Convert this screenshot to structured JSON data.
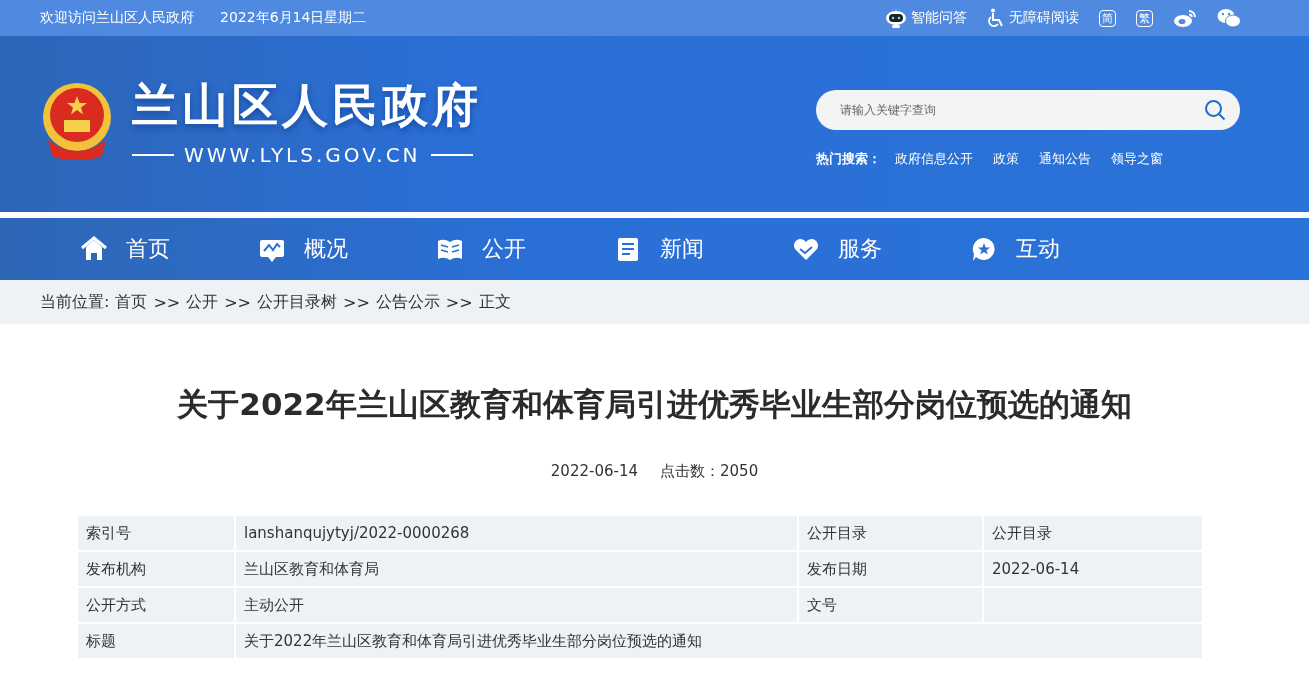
{
  "top_bar": {
    "welcome": "欢迎访问兰山区人民政府",
    "date": "2022年6月14日星期二",
    "tools": [
      {
        "kind": "robot",
        "label": "智能问答"
      },
      {
        "kind": "wheelchair",
        "label": "无障碍阅读"
      },
      {
        "kind": "boxed",
        "label": "简"
      },
      {
        "kind": "boxed",
        "label": "繁"
      },
      {
        "kind": "weibo"
      },
      {
        "kind": "wechat"
      }
    ]
  },
  "header": {
    "site_name": "兰山区人民政府",
    "domain": "WWW.LYLS.GOV.CN",
    "search": {
      "placeholder": "请输入关键字查询"
    },
    "hot_label": "热门搜索：",
    "hot_links": [
      "政府信息公开",
      "政策",
      "通知公告",
      "领导之窗"
    ]
  },
  "nav": [
    {
      "kind": "home",
      "label": "首页"
    },
    {
      "kind": "overview",
      "label": "概况"
    },
    {
      "kind": "book",
      "label": "公开"
    },
    {
      "kind": "news",
      "label": "新闻"
    },
    {
      "kind": "heart",
      "label": "服务"
    },
    {
      "kind": "chat",
      "label": "互动"
    }
  ],
  "breadcrumb": {
    "label": "当前位置:",
    "items": [
      "首页",
      "公开",
      "公开目录树",
      "公告公示",
      "正文"
    ],
    "separator": ">>"
  },
  "article": {
    "title": "关于2022年兰山区教育和体育局引进优秀毕业生部分岗位预选的通知",
    "date": "2022-06-14",
    "views": "点击数：2050"
  },
  "info_table": [
    [
      {
        "text": "索引号"
      },
      {
        "text": "lanshanqujytyj/2022-0000268"
      },
      {
        "text": "公开目录"
      },
      {
        "text": "公开目录"
      }
    ],
    [
      {
        "text": "发布机构"
      },
      {
        "text": "兰山区教育和体育局"
      },
      {
        "text": "发布日期"
      },
      {
        "text": "2022-06-14"
      }
    ],
    [
      {
        "text": "公开方式"
      },
      {
        "text": "主动公开"
      },
      {
        "text": "文号"
      }
    ],
    [
      {
        "text": "标题"
      },
      {
        "text": "关于2022年兰山区教育和体育局引进优秀毕业生部分岗位预选的通知"
      }
    ]
  ]
}
